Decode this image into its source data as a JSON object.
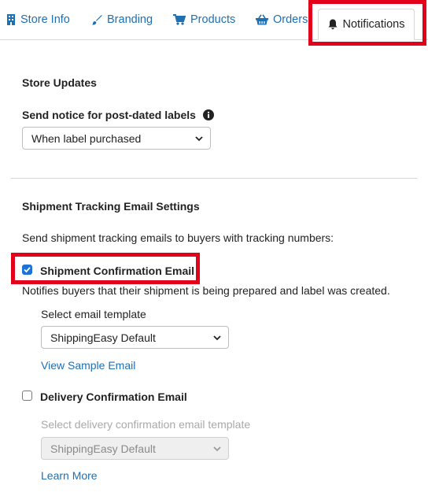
{
  "tabs": [
    {
      "label": "Store Info",
      "icon": "building-icon"
    },
    {
      "label": "Branding",
      "icon": "paintbrush-icon"
    },
    {
      "label": "Products",
      "icon": "cart-icon"
    },
    {
      "label": "Orders",
      "icon": "basket-icon"
    },
    {
      "label": "Notifications",
      "icon": "bell-icon",
      "active": true
    }
  ],
  "store_updates": {
    "heading": "Store Updates",
    "post_dated_label": "Send notice for post-dated labels",
    "post_dated_value": "When label purchased"
  },
  "tracking": {
    "heading": "Shipment Tracking Email Settings",
    "intro": "Send shipment tracking emails to buyers with tracking numbers:",
    "shipment_confirmation": {
      "label": "Shipment Confirmation Email",
      "checked": true,
      "description": "Notifies buyers that their shipment is being prepared and label was created.",
      "template_label": "Select email template",
      "template_value": "ShippingEasy Default",
      "sample_link": "View Sample Email"
    },
    "delivery_confirmation": {
      "label": "Delivery Confirmation Email",
      "checked": false,
      "template_label": "Select delivery confirmation email template",
      "template_value": "ShippingEasy Default",
      "learn_more": "Learn More"
    }
  },
  "colors": {
    "link": "#1f6fb3",
    "highlight": "#e3001b",
    "checkbox": "#1a73d9"
  }
}
